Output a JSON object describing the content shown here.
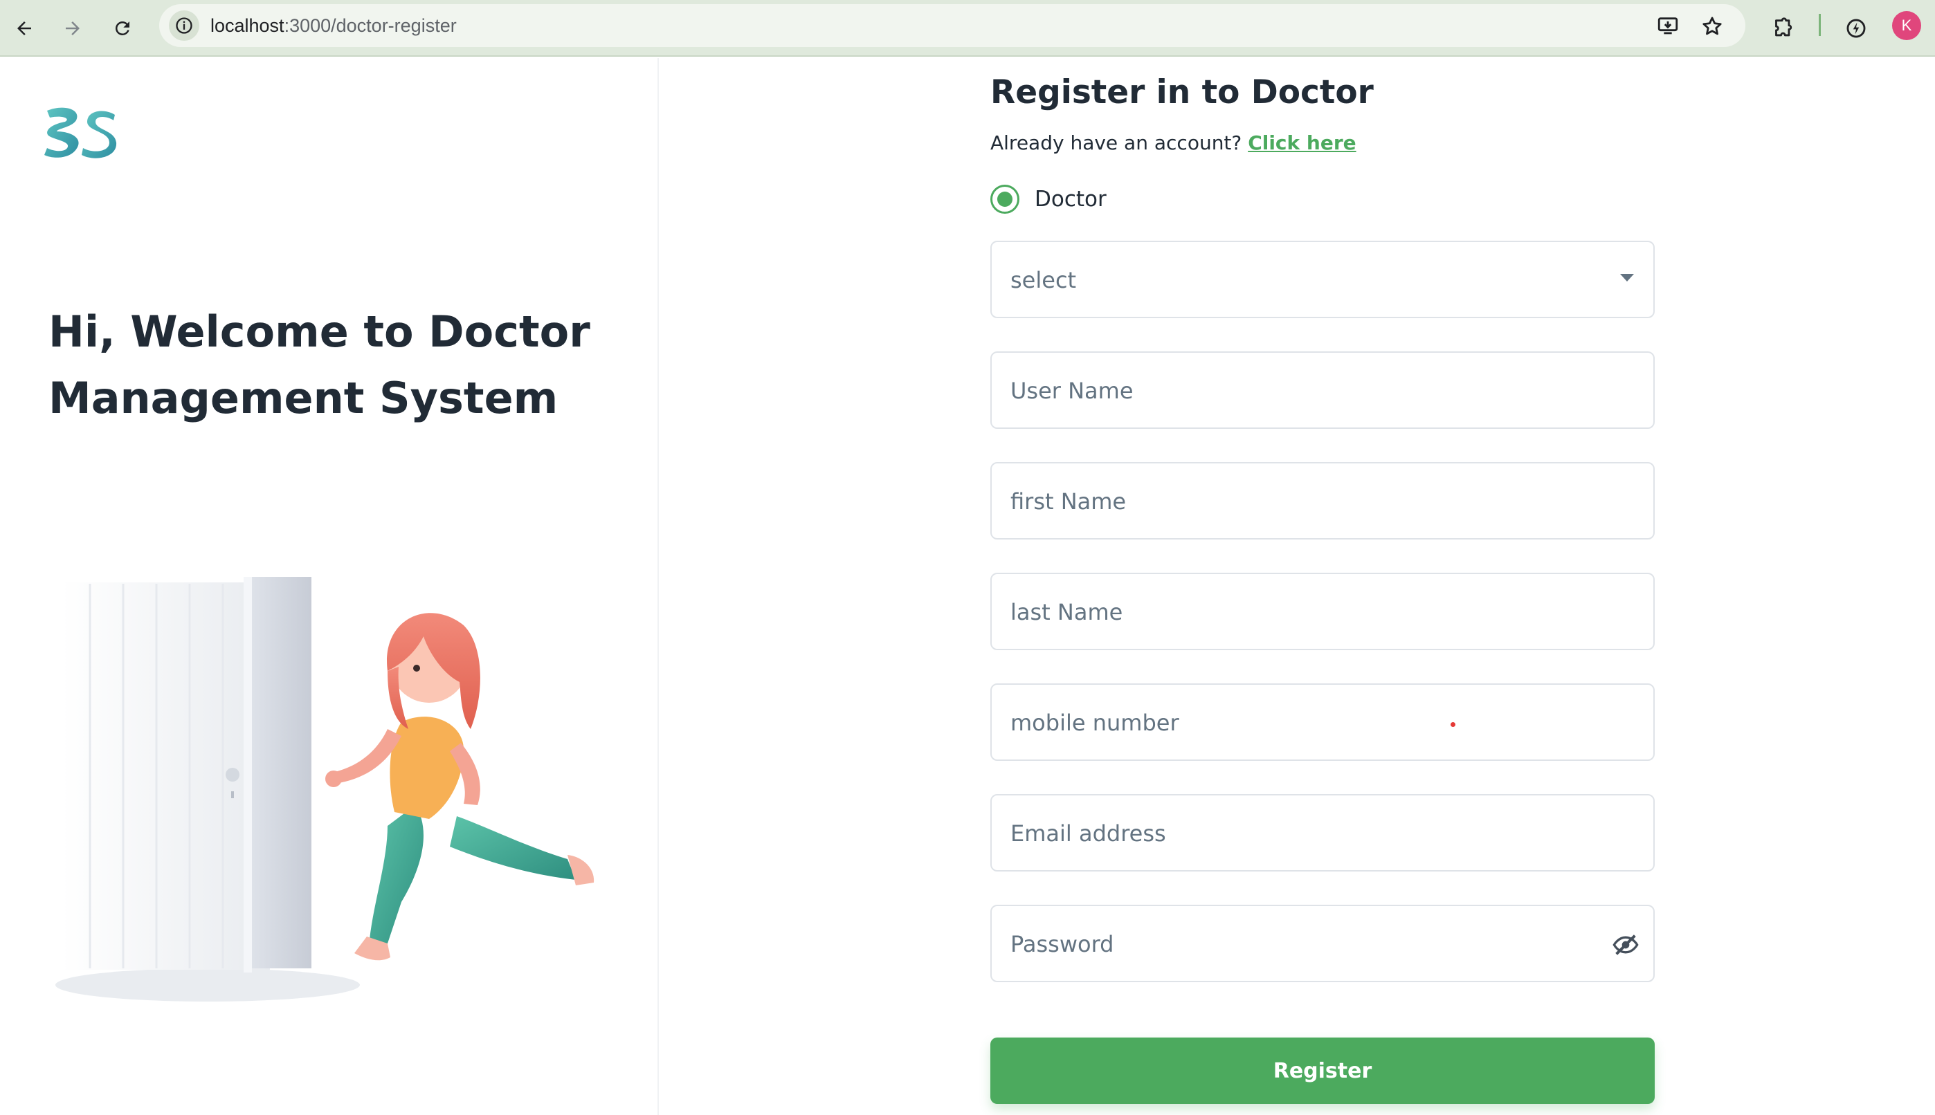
{
  "browser": {
    "url_host": "localhost",
    "url_path": ":3000/doctor-register",
    "profile_initial": "K"
  },
  "left": {
    "welcome_line1": "Hi, Welcome to Doctor",
    "welcome_line2": "Management System"
  },
  "form": {
    "title": "Register in to Doctor",
    "have_account_text": "Already have an account?",
    "login_link": "Click here",
    "role_label": "Doctor",
    "select_placeholder": "select",
    "username_placeholder": "User Name",
    "first_name_placeholder": "first Name",
    "last_name_placeholder": "last Name",
    "mobile_placeholder": "mobile number",
    "email_placeholder": "Email address",
    "password_placeholder": "Password",
    "register_label": "Register"
  },
  "colors": {
    "accent": "#4caa5e",
    "chrome_bg": "#dfe9dc",
    "text_primary": "#212b36",
    "placeholder": "#637381"
  },
  "icons": [
    "back-arrow-icon",
    "forward-arrow-icon",
    "reload-icon",
    "site-info-icon",
    "install-app-icon",
    "star-icon",
    "extensions-icon",
    "performance-icon",
    "chevron-down-icon",
    "eye-off-icon"
  ]
}
